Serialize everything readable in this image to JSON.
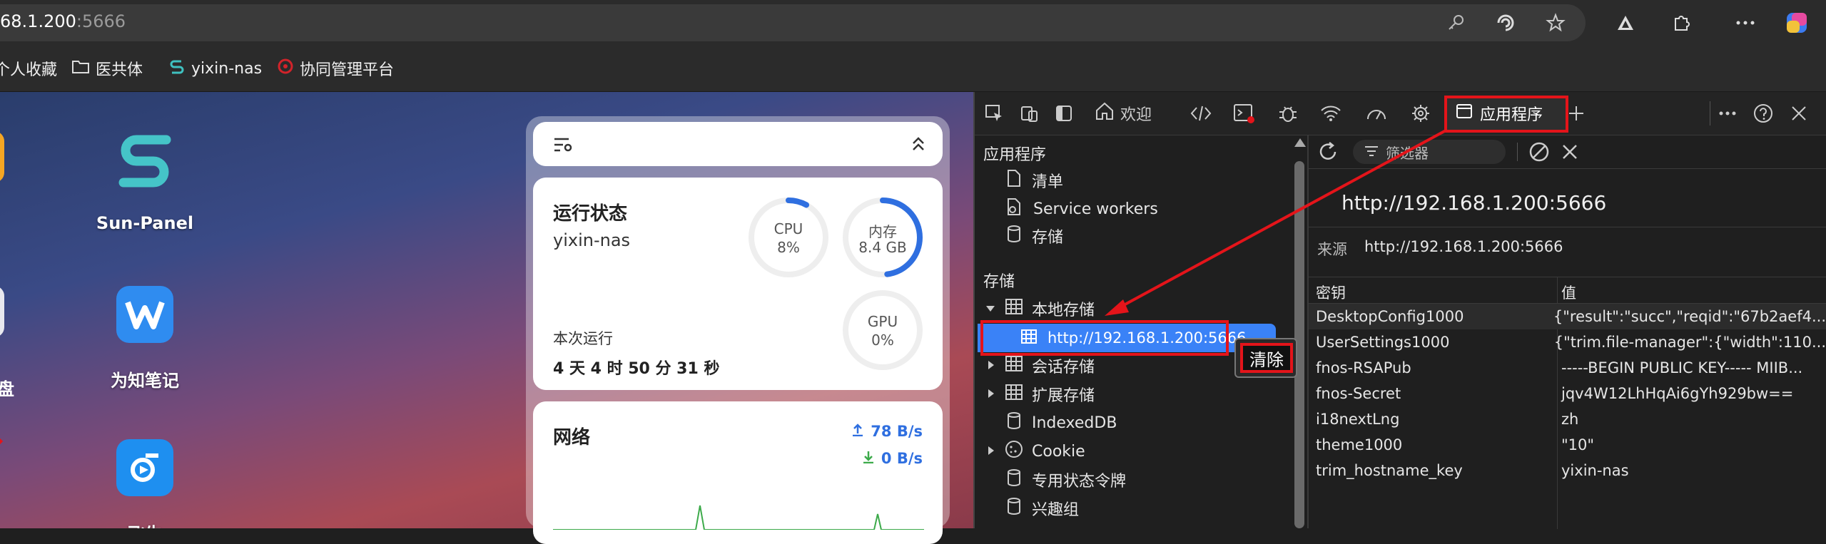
{
  "browser": {
    "url_host": "68.1.200",
    "url_port": ":5666",
    "bookmarks": [
      "个人收藏",
      "医共体",
      "yixin-nas",
      "协同管理平台"
    ]
  },
  "desktop": {
    "apps": [
      "Sun-Panel",
      "为知笔记",
      "飞牛"
    ],
    "left_partial_label": "盘",
    "widget": {
      "status_title": "运行状态",
      "host": "yixin-nas",
      "cpu_label": "CPU",
      "cpu_value": "8%",
      "cpu_fraction": 0.08,
      "mem_label": "内存",
      "mem_value": "8.4 GB",
      "mem_fraction": 0.48,
      "gpu_label": "GPU",
      "gpu_value": "0%",
      "gpu_fraction": 0,
      "uptime_label": "本次运行",
      "uptime_value": "4 天 4 时 50 分 31 秒",
      "network_title": "网络",
      "upload": "78 B/s",
      "download": "0 B/s"
    }
  },
  "devtools": {
    "tabs": {
      "welcome": "欢迎",
      "application": "应用程序"
    },
    "sidebar": {
      "app_section": "应用程序",
      "app_items": [
        "清单",
        "Service workers",
        "存储"
      ],
      "storage_section": "存储",
      "local_storage": "本地存储",
      "local_storage_origin": "http://192.168.1.200:5666",
      "context_menu_clear": "清除",
      "session_storage": "会话存储",
      "extension_storage": "扩展存储",
      "indexeddb": "IndexedDB",
      "cookie": "Cookie",
      "private_state_tokens": "专用状态令牌",
      "interest_groups": "兴趣组"
    },
    "main": {
      "filter_placeholder": "筛选器",
      "origin_title": "http://192.168.1.200:5666",
      "source_label": "来源",
      "source_value": "http://192.168.1.200:5666",
      "col_key": "密钥",
      "col_value": "值",
      "rows": [
        {
          "key": "DesktopConfig1000",
          "value": "{\"result\":\"succ\",\"reqid\":\"67b2aef4..."
        },
        {
          "key": "UserSettings1000",
          "value": "{\"trim.file-manager\":{\"width\":110..."
        },
        {
          "key": "fnos-RSAPub",
          "value": "-----BEGIN PUBLIC KEY----- MIIB..."
        },
        {
          "key": "fnos-Secret",
          "value": "jqv4W12LhHqAi6gYh929bw=="
        },
        {
          "key": "i18nextLng",
          "value": "zh"
        },
        {
          "key": "theme1000",
          "value": "\"10\""
        },
        {
          "key": "trim_hostname_key",
          "value": "yixin-nas"
        }
      ]
    }
  },
  "colors": {
    "highlight": "#e4141a",
    "accent_blue": "#2f6fe0",
    "selected_row": "#3a82f7"
  }
}
